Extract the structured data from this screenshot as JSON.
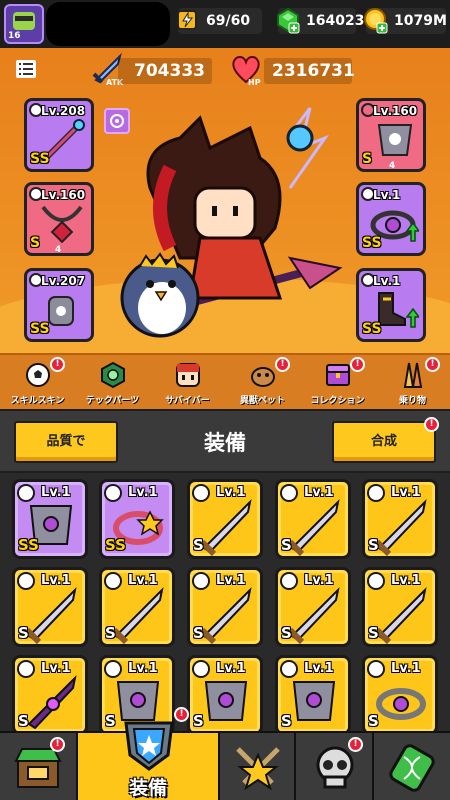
{
  "topbar": {
    "avatar_level": "16",
    "energy": "69/60",
    "gems": "164023",
    "gold": "1079M"
  },
  "hero": {
    "atk_label": "ATK",
    "atk_value": "704333",
    "hp_label": "HP",
    "hp_value": "2316731",
    "left_slots": [
      {
        "level": "Lv.208",
        "grade": "SS"
      },
      {
        "level": "Lv.160",
        "grade": "S",
        "stars": "4"
      },
      {
        "level": "Lv.207",
        "grade": "SS"
      }
    ],
    "right_slots": [
      {
        "level": "Lv.160",
        "grade": "S",
        "stars": "4"
      },
      {
        "level": "Lv.1",
        "grade": "SS"
      },
      {
        "level": "Lv.1",
        "grade": "SS"
      }
    ]
  },
  "categories": [
    {
      "label": "スキルスキン",
      "icon": "soccer-ball-icon"
    },
    {
      "label": "テックパーツ",
      "icon": "hex-gear-icon"
    },
    {
      "label": "サバイバー",
      "icon": "survivor-face-icon"
    },
    {
      "label": "異獣ペット",
      "icon": "pet-icon"
    },
    {
      "label": "コレクション",
      "icon": "chest-icon"
    },
    {
      "label": "乗り物",
      "icon": "surfboard-icon"
    }
  ],
  "equipment": {
    "title": "装備",
    "sort_label": "品質で",
    "merge_label": "合成"
  },
  "inventory": [
    {
      "level": "Lv.1",
      "grade": "SS",
      "type": "armor",
      "rarity": "purple"
    },
    {
      "level": "Lv.1",
      "grade": "SS",
      "type": "belt",
      "rarity": "purple"
    },
    {
      "level": "Lv.1",
      "grade": "S",
      "type": "sword",
      "rarity": "gold"
    },
    {
      "level": "Lv.1",
      "grade": "S",
      "type": "sword",
      "rarity": "gold"
    },
    {
      "level": "Lv.1",
      "grade": "S",
      "type": "sword",
      "rarity": "gold"
    },
    {
      "level": "Lv.1",
      "grade": "S",
      "type": "sword",
      "rarity": "gold"
    },
    {
      "level": "Lv.1",
      "grade": "S",
      "type": "sword",
      "rarity": "gold"
    },
    {
      "level": "Lv.1",
      "grade": "S",
      "type": "sword",
      "rarity": "gold"
    },
    {
      "level": "Lv.1",
      "grade": "S",
      "type": "sword",
      "rarity": "gold"
    },
    {
      "level": "Lv.1",
      "grade": "S",
      "type": "sword",
      "rarity": "gold"
    },
    {
      "level": "Lv.1",
      "grade": "S",
      "type": "spiked-sword",
      "rarity": "gold"
    },
    {
      "level": "Lv.1",
      "grade": "S",
      "type": "armor",
      "rarity": "gold"
    },
    {
      "level": "Lv.1",
      "grade": "S",
      "type": "armor",
      "rarity": "gold"
    },
    {
      "level": "Lv.1",
      "grade": "S",
      "type": "armor",
      "rarity": "gold"
    },
    {
      "level": "Lv.1",
      "grade": "S",
      "type": "ring",
      "rarity": "gold"
    }
  ],
  "nav": {
    "active_label": "装備"
  },
  "colors": {
    "hero_bg": "#e7801b",
    "gold_card": "#ffc61a",
    "purple_card": "#c48cf2",
    "red_card": "#f06a83",
    "badge": "#e8213b"
  }
}
